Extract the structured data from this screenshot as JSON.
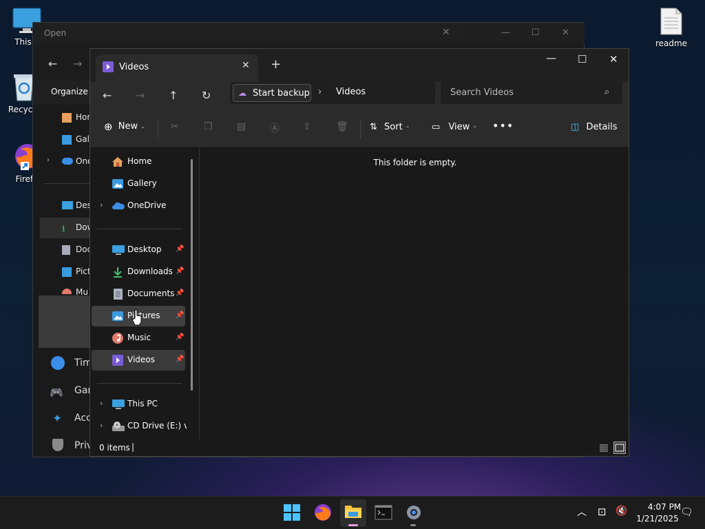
{
  "desktop": {
    "icons": [
      {
        "label": "This P"
      },
      {
        "label": "Recycle"
      },
      {
        "label": "Firefo"
      },
      {
        "label": "readme"
      }
    ]
  },
  "open_dialog": {
    "title": "Open",
    "organize_label": "Organize",
    "nav_items": [
      {
        "label": "Hon"
      },
      {
        "label": "Gall"
      },
      {
        "label": "One"
      },
      {
        "label": "Desk"
      },
      {
        "label": "Dow"
      },
      {
        "label": "Doc"
      },
      {
        "label": "Pict"
      },
      {
        "label": "Mu"
      }
    ],
    "behind_rows": [
      {
        "label": "Tim"
      },
      {
        "label": "Gan"
      },
      {
        "label": "Acc"
      },
      {
        "label": "Priv"
      }
    ]
  },
  "explorer": {
    "tab_title": "Videos",
    "address": {
      "backup_label": "Start backup",
      "current": "Videos"
    },
    "search_placeholder": "Search Videos",
    "toolbar": {
      "new_label": "New",
      "sort_label": "Sort",
      "view_label": "View",
      "details_label": "Details"
    },
    "nav": {
      "home": "Home",
      "gallery": "Gallery",
      "onedrive": "OneDrive",
      "desktop": "Desktop",
      "downloads": "Downloads",
      "documents": "Documents",
      "pictures": "Pictures",
      "music": "Music",
      "videos": "Videos",
      "this_pc": "This PC",
      "cd_drive": "CD Drive (E:) virt"
    },
    "empty_message": "This folder is empty.",
    "status": {
      "count": "0 items"
    }
  },
  "taskbar": {
    "time": "4:07 PM",
    "date": "1/21/2025"
  },
  "colors": {
    "accent": "#4cc2ff",
    "video_icon": "#7b5cd6"
  }
}
